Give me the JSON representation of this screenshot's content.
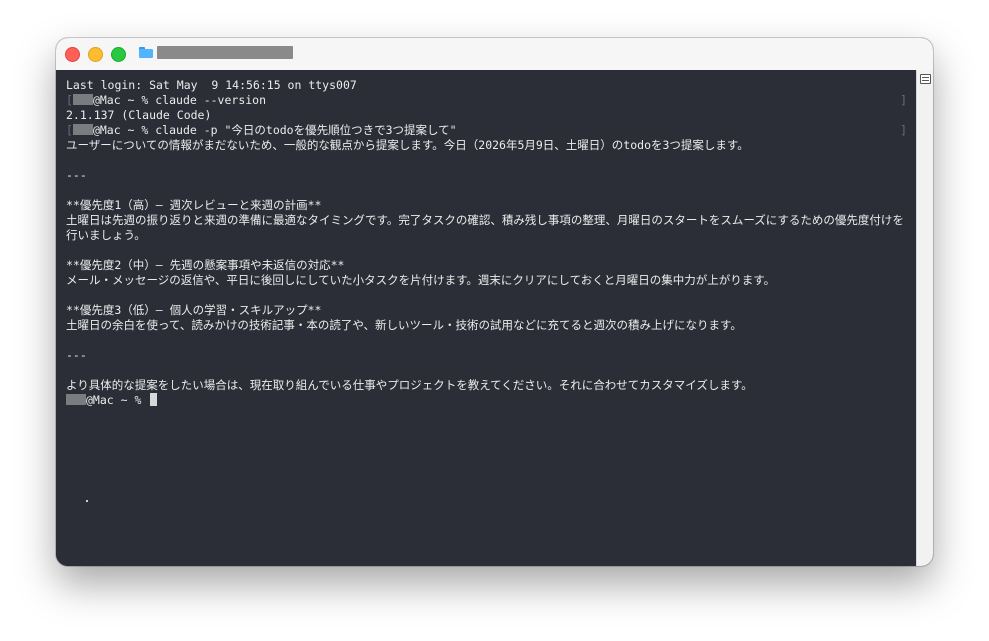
{
  "window": {
    "title_redacted": true
  },
  "terminal": {
    "lines": {
      "l0": "Last login: Sat May  9 14:56:15 on ttys007",
      "l1_prompt": "@Mac ~ % ",
      "l1_cmd": "claude --version",
      "l2": "2.1.137 (Claude Code)",
      "l3_prompt": "@Mac ~ % ",
      "l3_cmd": "claude -p \"今日のtodoを優先順位つきで3つ提案して\"",
      "l4": "ユーザーについての情報がまだないため、一般的な観点から提案します。今日（2026年5月9日、土曜日）のtodoを3つ提案します。",
      "sep1": "---",
      "p1_head": "**優先度1（高）– 週次レビューと来週の計画**",
      "p1_body": "土曜日は先週の振り返りと来週の準備に最適なタイミングです。完了タスクの確認、積み残し事項の整理、月曜日のスタートをスムーズにするための優先度付けを行いましょう。",
      "p2_head": "**優先度2（中）– 先週の懸案事項や未返信の対応**",
      "p2_body": "メール・メッセージの返信や、平日に後回しにしていた小タスクを片付けます。週末にクリアにしておくと月曜日の集中力が上がります。",
      "p3_head": "**優先度3（低）– 個人の学習・スキルアップ**",
      "p3_body": "土曜日の余白を使って、読みかけの技術記事・本の読了や、新しいツール・技術の試用などに充てると週次の積み上げになります。",
      "sep2": "---",
      "closing": "より具体的な提案をしたい場合は、現在取り組んでいる仕事やプロジェクトを教えてください。それに合わせてカスタマイズします。",
      "final_prompt": "@Mac ~ % "
    },
    "edge_mark_left": "[",
    "edge_mark_right": "]"
  },
  "colors": {
    "terminal_bg": "#2b2e37",
    "terminal_text": "#ececec",
    "close": "#ff5f57",
    "minimize": "#febc2e",
    "maximize": "#28c840"
  }
}
